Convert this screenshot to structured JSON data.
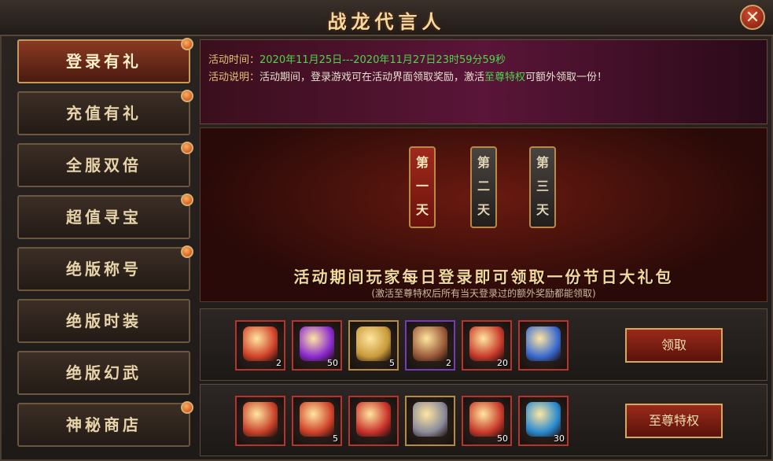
{
  "window": {
    "title": "战龙代言人",
    "close_glyph": "✕"
  },
  "sidebar": {
    "items": [
      {
        "label": "登录有礼",
        "active": true
      },
      {
        "label": "充值有礼"
      },
      {
        "label": "全服双倍"
      },
      {
        "label": "超值寻宝"
      },
      {
        "label": "绝版称号"
      },
      {
        "label": "绝版时装"
      },
      {
        "label": "绝版幻武"
      },
      {
        "label": "神秘商店"
      }
    ]
  },
  "banner": {
    "time_label": "活动时间：",
    "time_value": "2020年11月25日---2020年11月27日23时59分59秒",
    "desc_label": "活动说明：",
    "desc_before": "活动期间，登录游戏可在活动界面领取奖励，激活",
    "desc_highlight": "至尊特权",
    "desc_after": "可额外领取一份！"
  },
  "days": [
    {
      "chars": [
        "第",
        "一",
        "天"
      ],
      "state": "active"
    },
    {
      "chars": [
        "第",
        "二",
        "天"
      ],
      "state": "inactive"
    },
    {
      "chars": [
        "第",
        "三",
        "天"
      ],
      "state": "inactive"
    }
  ],
  "headline": "活动期间玩家每日登录即可领取一份节日大礼包",
  "subline": "(激活至尊特权后所有当天登录过的额外奖励都能领取)",
  "rows": [
    {
      "button": "领取",
      "items": [
        {
          "icon": "golden-key-icon",
          "count": "2",
          "color": "#d0422a"
        },
        {
          "icon": "purple-gem-pouch-icon",
          "count": "50",
          "color": "#8a2ad0"
        },
        {
          "icon": "horn-icon",
          "count": "5",
          "color": "#c89a3a"
        },
        {
          "icon": "scroll-roll-icon",
          "count": "2",
          "color": "#9a5a3a"
        },
        {
          "icon": "red-badge-icon",
          "count": "20",
          "color": "#c83a2a"
        },
        {
          "icon": "blue-scroll-icon",
          "count": "",
          "color": "#3a6ad0"
        }
      ]
    },
    {
      "button": "至尊特权",
      "items": [
        {
          "icon": "treasure-chest-icon",
          "count": "",
          "color": "#c8422a"
        },
        {
          "icon": "golden-key-icon",
          "count": "5",
          "color": "#d0422a"
        },
        {
          "icon": "dragon-sword-icon",
          "count": "",
          "color": "#c8322a"
        },
        {
          "icon": "silver-chest-icon",
          "count": "",
          "color": "#8a8a9a"
        },
        {
          "icon": "red-badge-icon",
          "count": "50",
          "color": "#c83a2a"
        },
        {
          "icon": "blue-orb-icon",
          "count": "30",
          "color": "#2a8ad0"
        }
      ]
    }
  ]
}
